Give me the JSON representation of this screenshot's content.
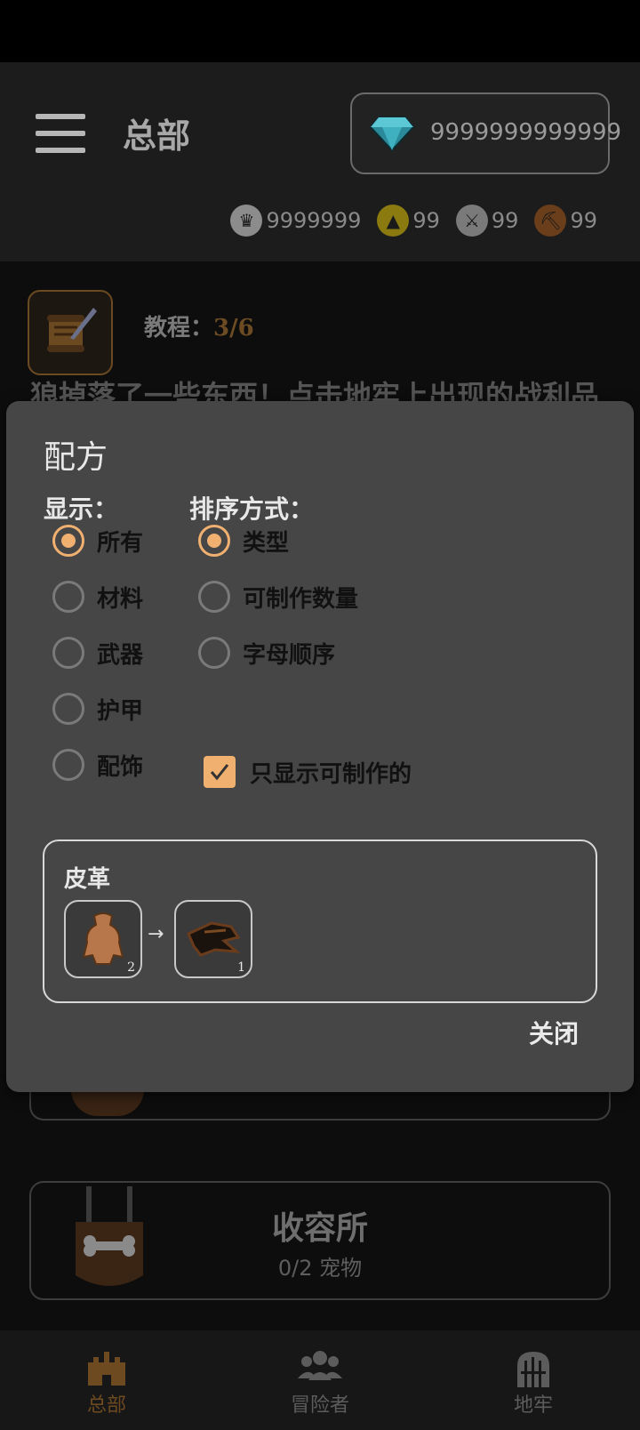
{
  "header": {
    "title": "总部",
    "gems": "9999999999999",
    "currencies": [
      {
        "icon": "crown-coin-icon",
        "value": "9999999",
        "color": "#8c8c8c",
        "glyph": "♛"
      },
      {
        "icon": "gold-mountain-coin-icon",
        "value": "99",
        "color": "#8a7a10",
        "glyph": "▲"
      },
      {
        "icon": "sword-coin-icon",
        "value": "99",
        "color": "#7a7a7a",
        "glyph": "⚔"
      },
      {
        "icon": "pickaxe-coin-icon",
        "value": "99",
        "color": "#6a3e1a",
        "glyph": "⛏"
      }
    ]
  },
  "tutorial": {
    "label": "教程：",
    "progress": "3/6",
    "text": "狼掉落了一些东西！点击地牢上出现的战利品"
  },
  "kennel": {
    "title": "收容所",
    "subtitle": "0/2 宠物"
  },
  "nav": {
    "items": [
      {
        "label": "总部",
        "icon": "castle-icon",
        "active": true
      },
      {
        "label": "冒险者",
        "icon": "group-icon",
        "active": false
      },
      {
        "label": "地牢",
        "icon": "dungeon-gate-icon",
        "active": false
      }
    ]
  },
  "dialog": {
    "title": "配方",
    "show_label": "显示：",
    "sort_label": "排序方式：",
    "show_options": [
      {
        "label": "所有",
        "checked": true
      },
      {
        "label": "材料",
        "checked": false
      },
      {
        "label": "武器",
        "checked": false
      },
      {
        "label": "护甲",
        "checked": false
      },
      {
        "label": "配饰",
        "checked": false
      }
    ],
    "sort_options": [
      {
        "label": "类型",
        "checked": true
      },
      {
        "label": "可制作数量",
        "checked": false
      },
      {
        "label": "字母顺序",
        "checked": false
      }
    ],
    "only_craftable": {
      "label": "只显示可制作的",
      "checked": true
    },
    "recipe": {
      "name": "皮革",
      "input": {
        "icon": "hide-icon",
        "count": "2"
      },
      "output": {
        "icon": "leather-icon",
        "count": "1"
      }
    },
    "close_label": "关闭"
  },
  "colors": {
    "accent": "#f0b070",
    "dialog_bg": "#464646"
  }
}
